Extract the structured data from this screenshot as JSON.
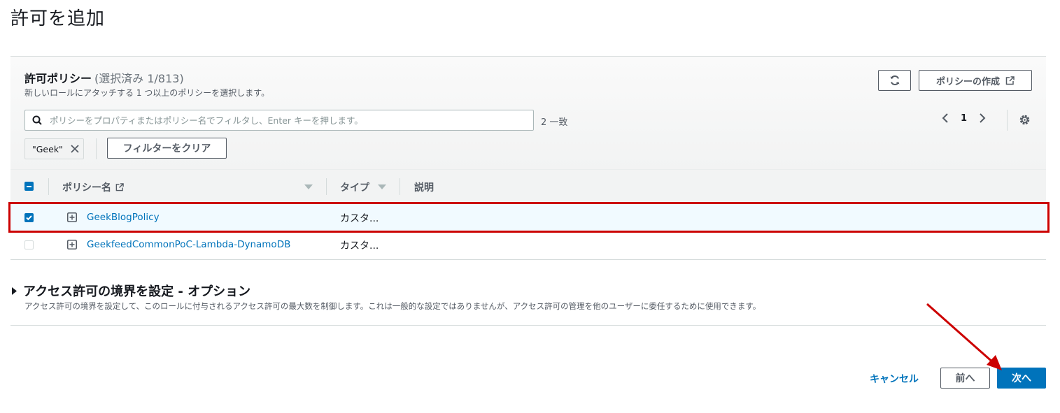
{
  "page": {
    "title": "許可を追加"
  },
  "panel": {
    "title": "許可ポリシー",
    "count": "(選択済み 1/813)",
    "description": "新しいロールにアタッチする 1 つ以上のポリシーを選択します。",
    "create_policy_label": "ポリシーの作成",
    "search_placeholder": "ポリシーをプロパティまたはポリシー名でフィルタし、Enter キーを押します。",
    "match_count": "2 一致",
    "page_number": "1",
    "filter_token": "\"Geek\"",
    "clear_filter_label": "フィルターをクリア"
  },
  "table": {
    "columns": [
      "ポリシー名",
      "タイプ",
      "説明"
    ],
    "rows": [
      {
        "name": "GeekBlogPolicy",
        "type": "カスタ...",
        "description": "",
        "selected": true
      },
      {
        "name": "GeekfeedCommonPoC-Lambda-DynamoDB",
        "type": "カスタ...",
        "description": "",
        "selected": false
      }
    ]
  },
  "boundary": {
    "title": "アクセス許可の境界を設定 - オプション",
    "description": "アクセス許可の境界を設定して、このロールに付与されるアクセス許可の最大数を制御します。これは一般的な設定ではありませんが、アクセス許可の管理を他のユーザーに委任するために使用できます。"
  },
  "footer": {
    "cancel_label": "キャンセル",
    "prev_label": "前へ",
    "next_label": "次へ"
  },
  "colors": {
    "primary": "#0073bb",
    "annotation_red": "#cc0000",
    "selected_row_bg": "#f1faff"
  },
  "icons": [
    "refresh-icon",
    "external-link-icon",
    "search-icon",
    "chevron-left-icon",
    "chevron-right-icon",
    "gear-icon",
    "close-icon",
    "sort-down-icon",
    "expand-plus-icon",
    "caret-right-icon"
  ]
}
